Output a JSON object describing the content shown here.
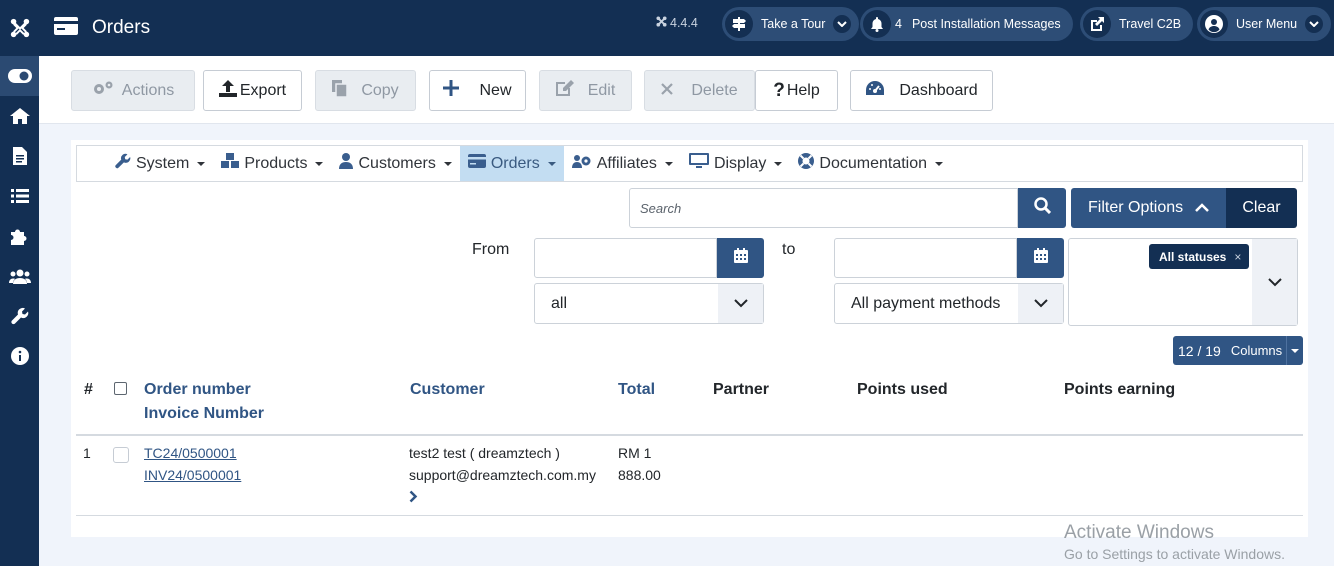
{
  "header": {
    "page_title": "Orders",
    "version": "4.4.4",
    "take_tour": "Take a Tour",
    "notifications_count": "4",
    "post_install": "Post Installation Messages",
    "site_name": "Travel C2B",
    "user_menu": "User Menu"
  },
  "toolbar": {
    "actions": "Actions",
    "export": "Export",
    "copy": "Copy",
    "new": "New",
    "edit": "Edit",
    "delete": "Delete",
    "help": "Help",
    "dashboard": "Dashboard"
  },
  "menu": {
    "system": "System",
    "products": "Products",
    "customers": "Customers",
    "orders": "Orders",
    "affiliates": "Affiliates",
    "display": "Display",
    "documentation": "Documentation"
  },
  "filters": {
    "search_placeholder": "Search",
    "filter_options": "Filter Options",
    "clear": "Clear",
    "from_label": "From",
    "to_label": "to",
    "from_value": "",
    "to_value": "",
    "type_select": "all",
    "payment_select": "All payment methods",
    "status_tag": "All statuses",
    "status_tag_remove": "×"
  },
  "columns": {
    "shown": "12",
    "separator": "/",
    "total": "19",
    "label": "Columns"
  },
  "table": {
    "headers": {
      "num": "#",
      "order_number": "Order number",
      "invoice_number": "Invoice Number",
      "customer": "Customer",
      "total": "Total",
      "partner": "Partner",
      "points_used": "Points used",
      "points_earning": "Points earning"
    },
    "rows": [
      {
        "num": "1",
        "order_number": "TC24/0500001",
        "invoice_number": "INV24/0500001",
        "customer_name": "test2 test ( dreamztech )",
        "customer_email": "support@dreamztech.com.my",
        "total_line1": "RM 1",
        "total_line2": "888.00"
      }
    ]
  },
  "watermark": {
    "title": "Activate Windows",
    "subtitle": "Go to Settings to activate Windows."
  }
}
